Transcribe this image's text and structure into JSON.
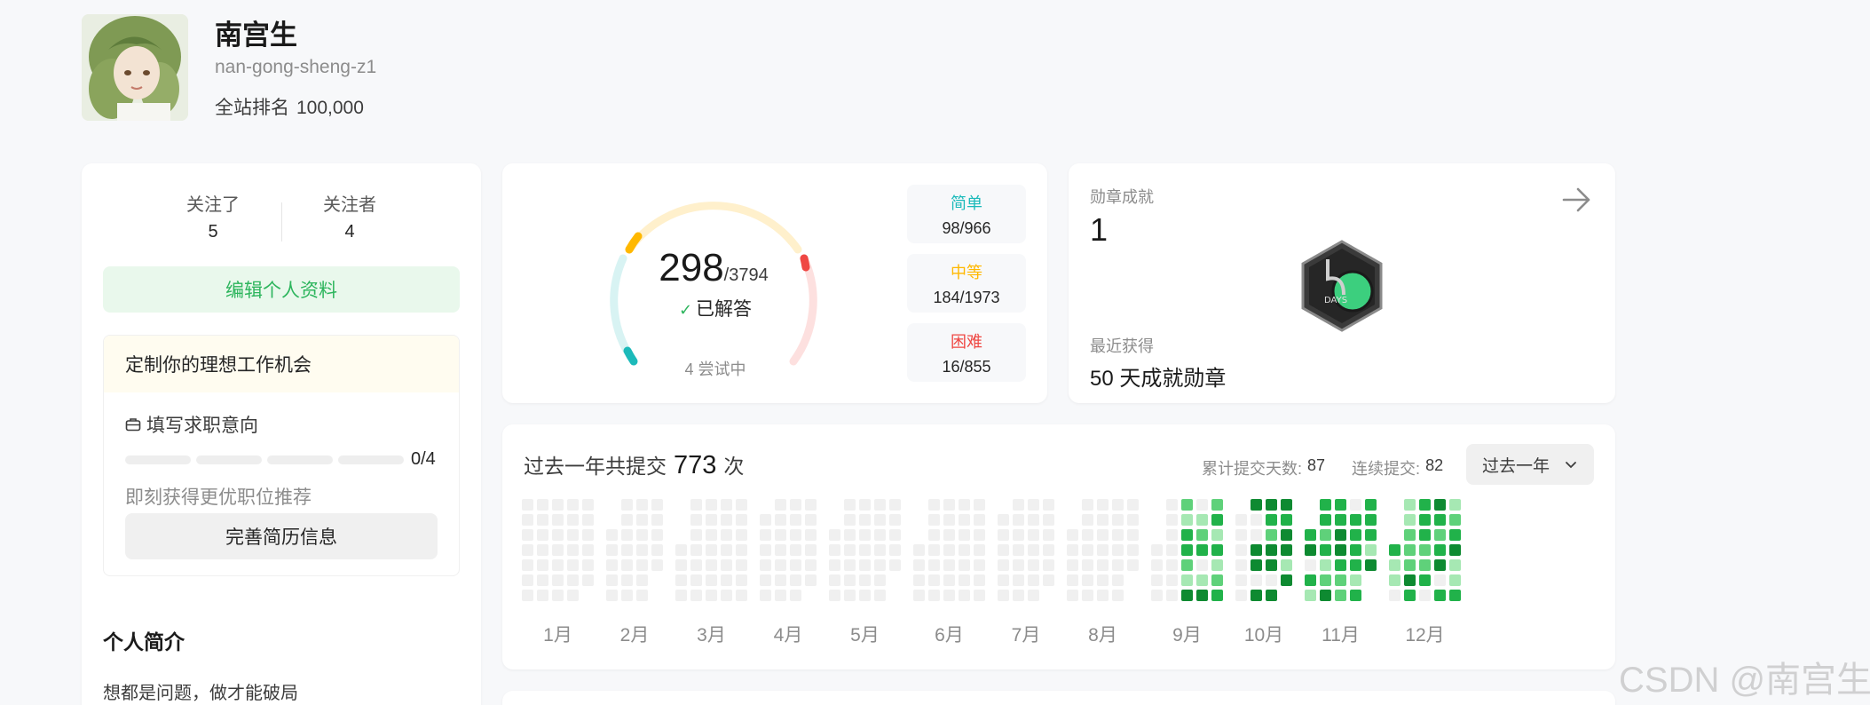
{
  "profile": {
    "name": "南宫生",
    "slug": "nan-gong-sheng-z1",
    "rank_label": "全站排名",
    "rank_value": "100,000"
  },
  "follow": {
    "following_label": "关注了",
    "following_count": "5",
    "followers_label": "关注者",
    "followers_count": "4"
  },
  "edit_profile_label": "编辑个人资料",
  "job": {
    "title": "定制你的理想工作机会",
    "subtitle": "填写求职意向",
    "progress_text": "0/4",
    "progress_done": 0,
    "progress_total": 4,
    "hint": "即刻获得更优职位推荐",
    "button": "完善简历信息"
  },
  "bio": {
    "title": "个人简介",
    "text": "想都是问题，做才能破局"
  },
  "solved": {
    "count": "298",
    "total": "/3794",
    "label": "已解答",
    "trying": "4 尝试中",
    "difficulties": [
      {
        "label": "简单",
        "value": "98/966",
        "color": "#1cbaba"
      },
      {
        "label": "中等",
        "value": "184/1973",
        "color": "#ffb800"
      },
      {
        "label": "困难",
        "value": "16/855",
        "color": "#ef4743"
      }
    ]
  },
  "badges": {
    "title": "勋章成就",
    "count": "1",
    "badge_text": "DAYS",
    "badge_number": "50",
    "recent_label": "最近获得",
    "recent_name": "50 天成就勋章"
  },
  "calendar": {
    "title_prefix": "过去一年共提交",
    "count": "773",
    "title_suffix": "次",
    "total_days_label": "累计提交天数:",
    "total_days": "87",
    "streak_label": "连续提交:",
    "streak": "82",
    "period": "过去一年",
    "months": [
      "1月",
      "2月",
      "3月",
      "4月",
      "5月",
      "6月",
      "7月",
      "8月",
      "9月",
      "10月",
      "11月",
      "12月"
    ],
    "colors": {
      "empty": "#f0f0f0",
      "l1": "#a6e8b3",
      "l2": "#5fd17a",
      "l3": "#21b24a",
      "l4": "#0e8a31"
    }
  },
  "watermark": "CSDN @南宫生"
}
